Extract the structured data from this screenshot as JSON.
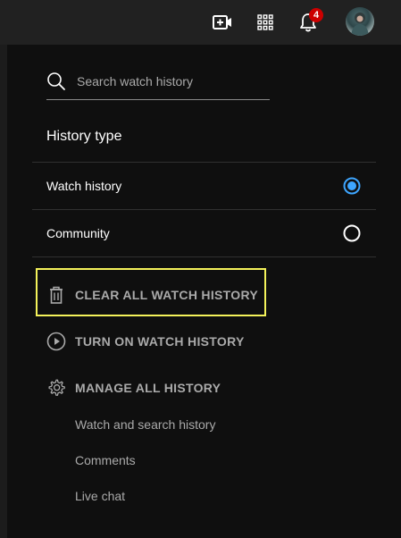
{
  "topbar": {
    "create_icon": "video-plus-icon",
    "apps_icon": "apps-grid-icon",
    "notifications_icon": "bell-icon",
    "notification_count": "4",
    "badge_color": "#cc0000",
    "avatar": "user-avatar"
  },
  "search": {
    "placeholder": "Search watch history",
    "value": "",
    "icon": "search-icon"
  },
  "history_type": {
    "title": "History type",
    "options": [
      {
        "label": "Watch history",
        "selected": true
      },
      {
        "label": "Community",
        "selected": false
      }
    ],
    "selected_color": "#3ea6ff"
  },
  "actions": {
    "clear": {
      "label": "CLEAR ALL WATCH HISTORY",
      "icon": "trash-icon"
    },
    "turn_on": {
      "label": "TURN ON WATCH HISTORY",
      "icon": "play-circle-icon"
    },
    "manage": {
      "label": "MANAGE ALL HISTORY",
      "icon": "gear-icon"
    }
  },
  "manage_links": [
    {
      "label": "Watch and search history"
    },
    {
      "label": "Comments"
    },
    {
      "label": "Live chat"
    }
  ],
  "highlight_color": "#f4f25a"
}
